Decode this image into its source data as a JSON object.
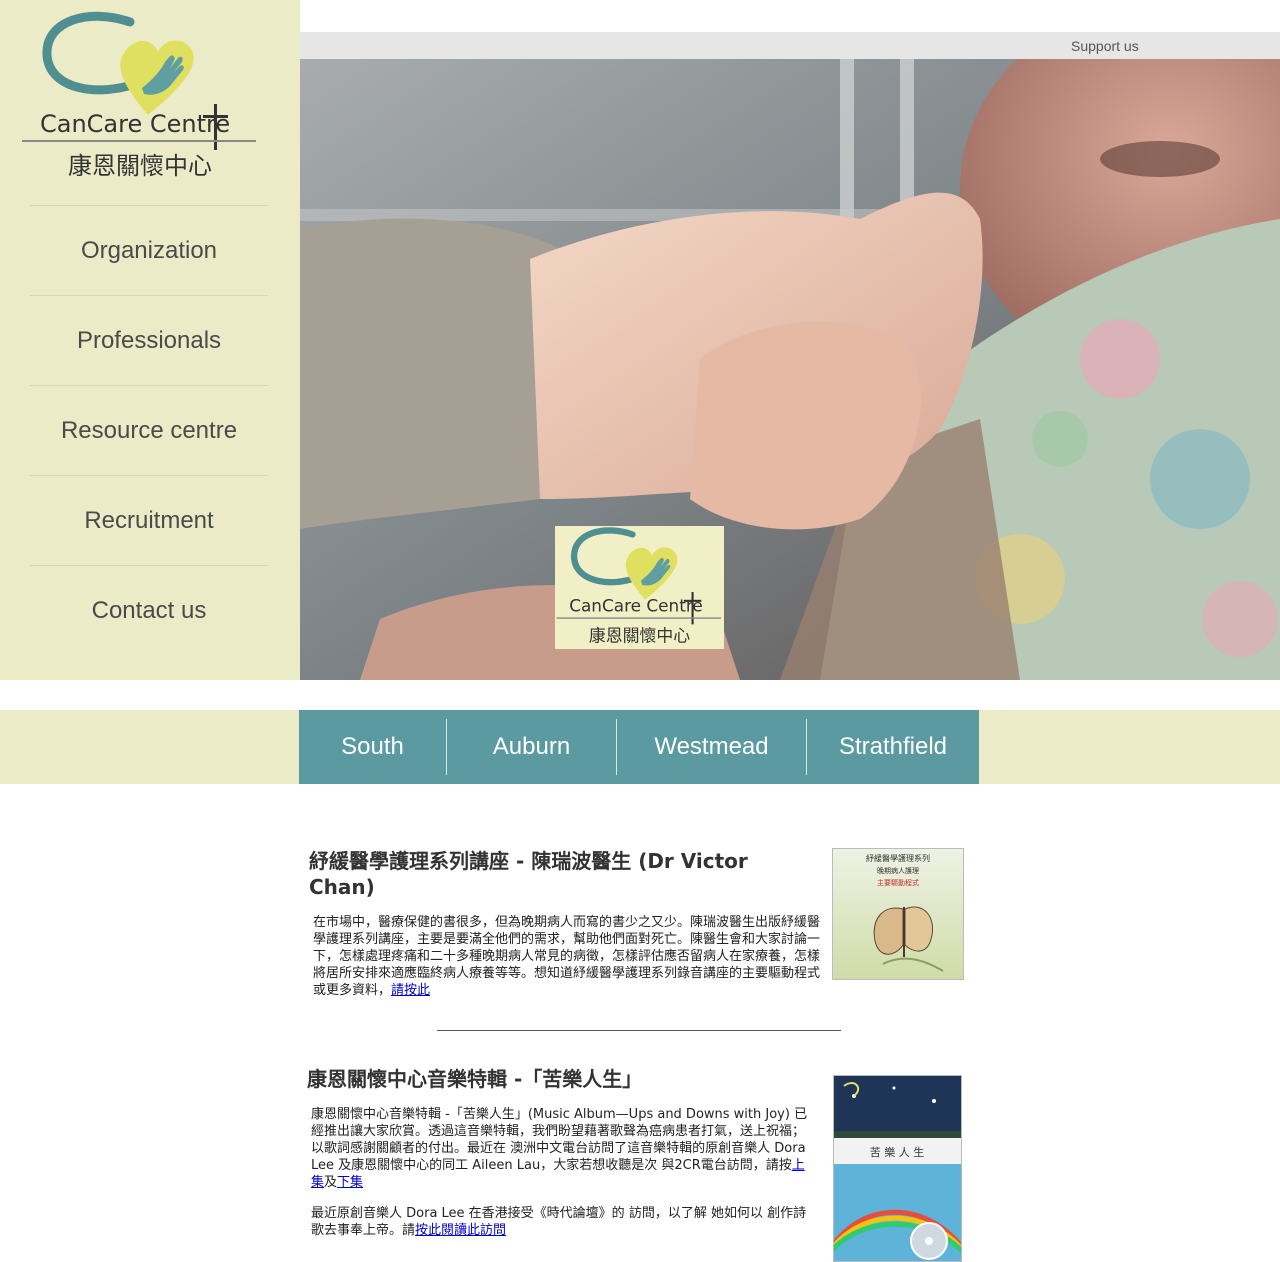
{
  "brand": {
    "name_en": "CanCare Centre",
    "name_zh": "康恩關懷中心"
  },
  "nav": {
    "items": [
      {
        "label": "Organization"
      },
      {
        "label": "Professionals"
      },
      {
        "label": "Resource centre"
      },
      {
        "label": "Recruitment"
      },
      {
        "label": "Contact us"
      }
    ]
  },
  "topbar": {
    "support_label": "Support us"
  },
  "locations": {
    "tabs": [
      {
        "label": "South"
      },
      {
        "label": "Auburn"
      },
      {
        "label": "Westmead"
      },
      {
        "label": "Strathfield"
      }
    ]
  },
  "articles": [
    {
      "title": "紓緩醫學護理系列講座 - 陳瑞波醫生 (Dr Victor Chan)",
      "body": "在市場中，醫療保健的書很多，但為晚期病人而寫的書少之又少。陳瑞波醫生出版紓緩醫學護理系列講座，主要是要滿全他們的需求，幫助他們面對死亡。陳醫生會和大家討論一下，怎樣處理疼痛和二十多種晚期病人常見的病徵，怎樣評估應否留病人在家療養，怎樣將居所安排來適應臨終病人療養等等。想知道紓緩醫學護理系列錄音講座的主要驅動程式或更多資料，",
      "link": "請按此",
      "thumb_line1": "紓緩醫學護理系列",
      "thumb_line2": "晚期病人護理",
      "thumb_line3": "主要驅動程式"
    },
    {
      "title": "康恩關懷中心音樂特輯 -「苦樂人生」",
      "para1": "康恩關懷中心音樂特輯 -「苦樂人生」(Music Album—Ups and Downs with Joy) 已經推出讓大家欣賞。透過這音樂特輯，我們盼望藉著歌聲為癌病患者打氣，送上祝福；以歌詞感謝關顧者的付出。最近在 澳洲中文電台訪問了這音樂特輯的原創音樂人 Dora Lee 及康恩關懷中心的同工 Aileen Lau，大家若想收聽是次 與2CR電台訪問，請按",
      "link1": "上集",
      "and": "及",
      "link2": "下集",
      "para2": "最近原創音樂人 Dora Lee 在香港接受《時代論壇》的 訪問，以了解 她如何以 創作詩歌去事奉上帝。請",
      "link3": "按此閱讀此訪問",
      "thumb_title": "苦 樂 人 生"
    }
  ],
  "colors": {
    "sidebar_bg": "#ecebc8",
    "tab_bg": "#5a9aa0",
    "logo_teal": "#4f8f92",
    "logo_yellow": "#e0e060"
  }
}
